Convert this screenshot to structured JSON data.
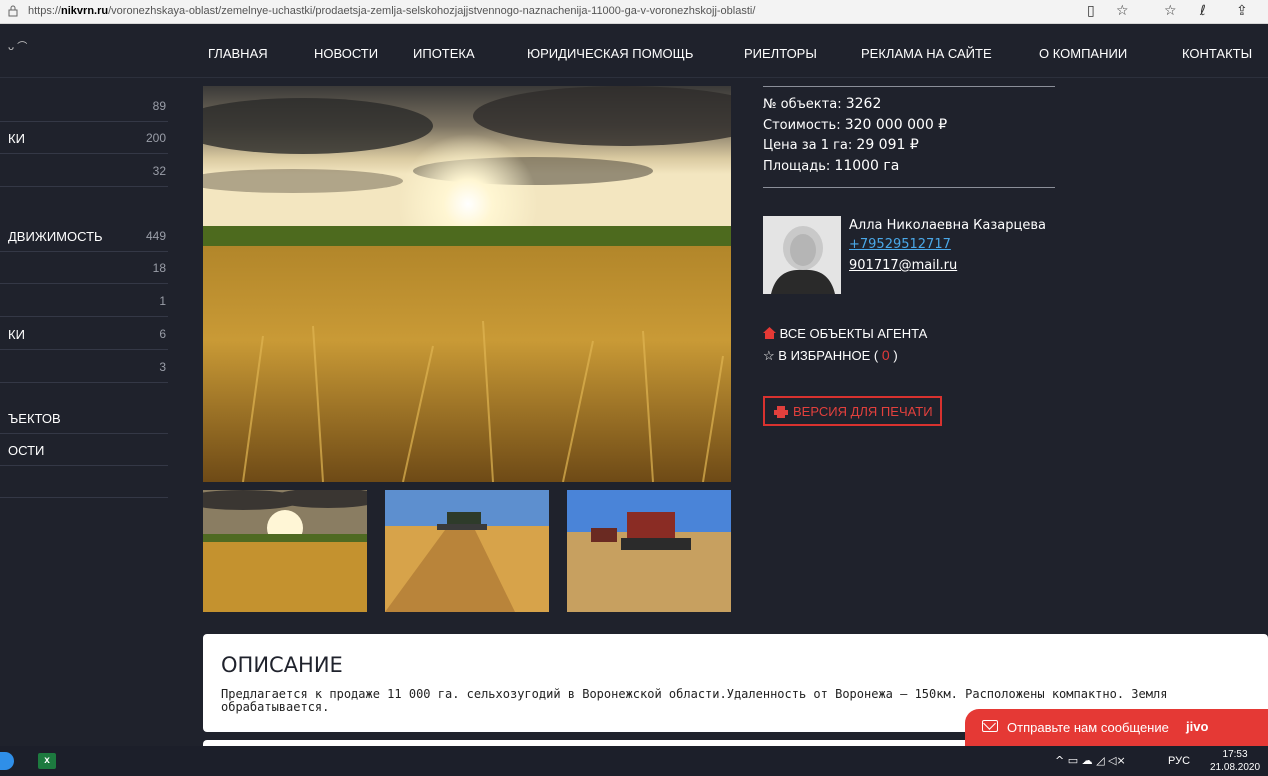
{
  "browser": {
    "url_prefix": "https://",
    "url_domain": "nikvrn.ru",
    "url_path": "/voronezhskaya-oblast/zemelnye-uchastki/prodaetsja-zemlja-selskohozjajjstvennogo-naznachenija-11000-ga-v-voronezhskojj-oblasti/",
    "icons": [
      "lock-icon",
      "reading-view-icon",
      "favorite-star-icon",
      "favorites-bar-icon",
      "pen-icon",
      "share-icon"
    ]
  },
  "nav": {
    "logo": "ᴗ ⌒",
    "items": [
      "ГЛАВНАЯ",
      "НОВОСТИ",
      "ИПОТЕКА",
      "ЮРИДИЧЕСКАЯ ПОМОЩЬ",
      "РИЕЛТОРЫ",
      "РЕКЛАМА НА САЙТЕ",
      "О КОМПАНИИ",
      "КОНТАКТЫ"
    ]
  },
  "sidebar": {
    "items": [
      {
        "label": "",
        "count": "89"
      },
      {
        "label": "КИ",
        "count": "200"
      },
      {
        "label": "",
        "count": "32"
      },
      {
        "label": "ДВИЖИМОСТЬ",
        "count": "449"
      },
      {
        "label": "",
        "count": "18"
      },
      {
        "label": "",
        "count": "1"
      },
      {
        "label": "КИ",
        "count": "6"
      },
      {
        "label": "",
        "count": "3"
      },
      {
        "label": "ЪЕКТОВ",
        "count": ""
      },
      {
        "label": "ОСТИ",
        "count": ""
      },
      {
        "label": "",
        "count": ""
      }
    ]
  },
  "listing": {
    "object_label": "№ объекта:",
    "object_value": "3262",
    "price_label": "Стоимость:",
    "price_value": "320 000 000 ₽",
    "per_ha_label": "Цена за 1 га:",
    "per_ha_value": "29 091 ₽",
    "area_label": "Площадь:",
    "area_value": "11000 га"
  },
  "agent": {
    "name": "Алла Николаевна Казарцева",
    "phone": "+79529512717",
    "email": "901717@mail.ru",
    "all_objects": "ВСЕ ОБЪЕКТЫ АГЕНТА",
    "favorites_label": "В ИЗБРАННОЕ (",
    "favorites_count": "0",
    "favorites_close": ")",
    "print_label": "ВЕРСИЯ ДЛЯ ПЕЧАТИ"
  },
  "description": {
    "title": "ОПИСАНИЕ",
    "text": "Предлагается к продаже 11 000 га. сельхозугодий в Воронежской области.Удаленность от Воронежа – 150км. Расположены компактно. Земля обрабатывается."
  },
  "jivo": {
    "message": "Отправьте нам сообщение",
    "brand": "jivo"
  },
  "taskbar": {
    "excel": "x",
    "tray": "^ ▭ ☁ ◿ ◁×",
    "lang": "РУС",
    "time": "17:53",
    "date": "21.08.2020"
  },
  "colors": {
    "background": "#1f222c",
    "accent_red": "#e53935",
    "link_blue": "#4aa8e8"
  }
}
